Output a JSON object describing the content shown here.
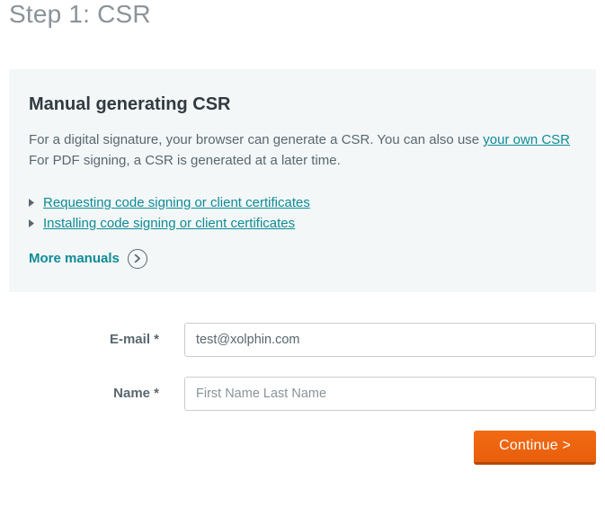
{
  "page": {
    "title": "Step 1: CSR"
  },
  "info": {
    "heading": "Manual generating CSR",
    "line1_a": "For a digital signature, your browser can generate a CSR. You can also use ",
    "line1_link": "your own CSR",
    "line2": "For PDF signing, a CSR is generated at a later time.",
    "links": [
      {
        "label": "Requesting code signing or client certificates"
      },
      {
        "label": "Installing code signing or client certificates"
      }
    ],
    "more_label": "More manuals"
  },
  "form": {
    "email_label": "E-mail *",
    "email_value": "test@xolphin.com",
    "name_label": "Name *",
    "name_placeholder": "First Name Last Name",
    "continue_label": "Continue >"
  }
}
